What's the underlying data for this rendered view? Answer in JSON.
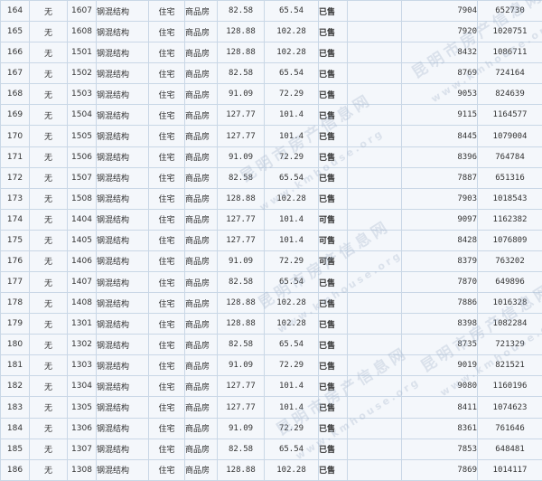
{
  "colors": {
    "sold": "#c6242b",
    "available": "#1a7d1a",
    "room_link": "#1b3f9a",
    "border": "#c9d7e6"
  },
  "watermark": {
    "cn": "昆明市房产信息网",
    "en": "www.kmhouse.org"
  },
  "rows": [
    {
      "idx": "164",
      "flag": "无",
      "room": "1607",
      "structure": "钢混结构",
      "use": "住宅",
      "kind": "商品房",
      "area1": "82.58",
      "area2": "65.54",
      "status": "已售",
      "status_type": "sold",
      "unit_price": "7904",
      "total": "652730"
    },
    {
      "idx": "165",
      "flag": "无",
      "room": "1608",
      "structure": "钢混结构",
      "use": "住宅",
      "kind": "商品房",
      "area1": "128.88",
      "area2": "102.28",
      "status": "已售",
      "status_type": "sold",
      "unit_price": "7920",
      "total": "1020751"
    },
    {
      "idx": "166",
      "flag": "无",
      "room": "1501",
      "structure": "钢混结构",
      "use": "住宅",
      "kind": "商品房",
      "area1": "128.88",
      "area2": "102.28",
      "status": "已售",
      "status_type": "sold",
      "unit_price": "8432",
      "total": "1086711"
    },
    {
      "idx": "167",
      "flag": "无",
      "room": "1502",
      "structure": "钢混结构",
      "use": "住宅",
      "kind": "商品房",
      "area1": "82.58",
      "area2": "65.54",
      "status": "已售",
      "status_type": "sold",
      "unit_price": "8769",
      "total": "724164"
    },
    {
      "idx": "168",
      "flag": "无",
      "room": "1503",
      "structure": "钢混结构",
      "use": "住宅",
      "kind": "商品房",
      "area1": "91.09",
      "area2": "72.29",
      "status": "已售",
      "status_type": "sold",
      "unit_price": "9053",
      "total": "824639"
    },
    {
      "idx": "169",
      "flag": "无",
      "room": "1504",
      "structure": "钢混结构",
      "use": "住宅",
      "kind": "商品房",
      "area1": "127.77",
      "area2": "101.4",
      "status": "已售",
      "status_type": "sold",
      "unit_price": "9115",
      "total": "1164577"
    },
    {
      "idx": "170",
      "flag": "无",
      "room": "1505",
      "structure": "钢混结构",
      "use": "住宅",
      "kind": "商品房",
      "area1": "127.77",
      "area2": "101.4",
      "status": "已售",
      "status_type": "sold",
      "unit_price": "8445",
      "total": "1079004"
    },
    {
      "idx": "171",
      "flag": "无",
      "room": "1506",
      "structure": "钢混结构",
      "use": "住宅",
      "kind": "商品房",
      "area1": "91.09",
      "area2": "72.29",
      "status": "已售",
      "status_type": "sold",
      "unit_price": "8396",
      "total": "764784"
    },
    {
      "idx": "172",
      "flag": "无",
      "room": "1507",
      "structure": "钢混结构",
      "use": "住宅",
      "kind": "商品房",
      "area1": "82.58",
      "area2": "65.54",
      "status": "已售",
      "status_type": "sold",
      "unit_price": "7887",
      "total": "651316"
    },
    {
      "idx": "173",
      "flag": "无",
      "room": "1508",
      "structure": "钢混结构",
      "use": "住宅",
      "kind": "商品房",
      "area1": "128.88",
      "area2": "102.28",
      "status": "已售",
      "status_type": "sold",
      "unit_price": "7903",
      "total": "1018543"
    },
    {
      "idx": "174",
      "flag": "无",
      "room": "1404",
      "structure": "钢混结构",
      "use": "住宅",
      "kind": "商品房",
      "area1": "127.77",
      "area2": "101.4",
      "status": "可售",
      "status_type": "available",
      "unit_price": "9097",
      "total": "1162382"
    },
    {
      "idx": "175",
      "flag": "无",
      "room": "1405",
      "structure": "钢混结构",
      "use": "住宅",
      "kind": "商品房",
      "area1": "127.77",
      "area2": "101.4",
      "status": "可售",
      "status_type": "available",
      "unit_price": "8428",
      "total": "1076809"
    },
    {
      "idx": "176",
      "flag": "无",
      "room": "1406",
      "structure": "钢混结构",
      "use": "住宅",
      "kind": "商品房",
      "area1": "91.09",
      "area2": "72.29",
      "status": "可售",
      "status_type": "available",
      "unit_price": "8379",
      "total": "763202"
    },
    {
      "idx": "177",
      "flag": "无",
      "room": "1407",
      "structure": "钢混结构",
      "use": "住宅",
      "kind": "商品房",
      "area1": "82.58",
      "area2": "65.54",
      "status": "已售",
      "status_type": "sold",
      "unit_price": "7870",
      "total": "649896"
    },
    {
      "idx": "178",
      "flag": "无",
      "room": "1408",
      "structure": "钢混结构",
      "use": "住宅",
      "kind": "商品房",
      "area1": "128.88",
      "area2": "102.28",
      "status": "已售",
      "status_type": "sold",
      "unit_price": "7886",
      "total": "1016328"
    },
    {
      "idx": "179",
      "flag": "无",
      "room": "1301",
      "structure": "钢混结构",
      "use": "住宅",
      "kind": "商品房",
      "area1": "128.88",
      "area2": "102.28",
      "status": "已售",
      "status_type": "sold",
      "unit_price": "8398",
      "total": "1082284"
    },
    {
      "idx": "180",
      "flag": "无",
      "room": "1302",
      "structure": "钢混结构",
      "use": "住宅",
      "kind": "商品房",
      "area1": "82.58",
      "area2": "65.54",
      "status": "已售",
      "status_type": "sold",
      "unit_price": "8735",
      "total": "721329"
    },
    {
      "idx": "181",
      "flag": "无",
      "room": "1303",
      "structure": "钢混结构",
      "use": "住宅",
      "kind": "商品房",
      "area1": "91.09",
      "area2": "72.29",
      "status": "已售",
      "status_type": "sold",
      "unit_price": "9019",
      "total": "821521"
    },
    {
      "idx": "182",
      "flag": "无",
      "room": "1304",
      "structure": "钢混结构",
      "use": "住宅",
      "kind": "商品房",
      "area1": "127.77",
      "area2": "101.4",
      "status": "已售",
      "status_type": "sold",
      "unit_price": "9080",
      "total": "1160196"
    },
    {
      "idx": "183",
      "flag": "无",
      "room": "1305",
      "structure": "钢混结构",
      "use": "住宅",
      "kind": "商品房",
      "area1": "127.77",
      "area2": "101.4",
      "status": "已售",
      "status_type": "sold",
      "unit_price": "8411",
      "total": "1074623"
    },
    {
      "idx": "184",
      "flag": "无",
      "room": "1306",
      "structure": "钢混结构",
      "use": "住宅",
      "kind": "商品房",
      "area1": "91.09",
      "area2": "72.29",
      "status": "已售",
      "status_type": "sold",
      "unit_price": "8361",
      "total": "761646"
    },
    {
      "idx": "185",
      "flag": "无",
      "room": "1307",
      "structure": "钢混结构",
      "use": "住宅",
      "kind": "商品房",
      "area1": "82.58",
      "area2": "65.54",
      "status": "已售",
      "status_type": "sold",
      "unit_price": "7853",
      "total": "648481"
    },
    {
      "idx": "186",
      "flag": "无",
      "room": "1308",
      "structure": "钢混结构",
      "use": "住宅",
      "kind": "商品房",
      "area1": "128.88",
      "area2": "102.28",
      "status": "已售",
      "status_type": "sold",
      "unit_price": "7869",
      "total": "1014117"
    }
  ]
}
